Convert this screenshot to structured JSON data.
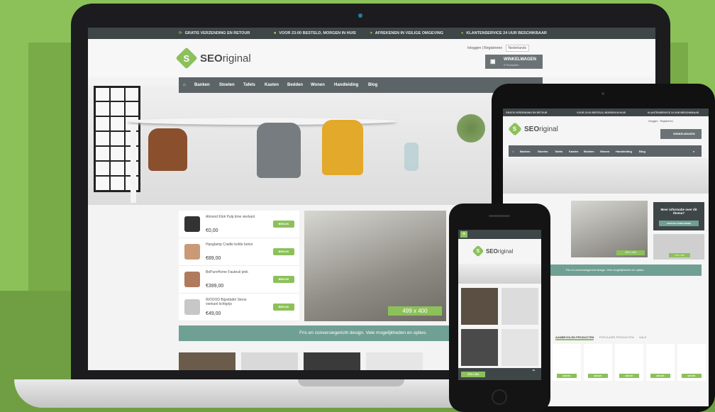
{
  "usps": [
    "GRATIS VERZENDING EN RETOUR",
    "VOOR 23:00 BESTELD, MORGEN IN HUIS",
    "AFREKENEN IN VEILIGE OMGEVING",
    "KLANTENSERVICE 24 UUR BESCHIKBAAR"
  ],
  "brand": {
    "bold": "SEO",
    "rest": "riginal",
    "mark": "S"
  },
  "header": {
    "login": "Inloggen",
    "register": "Registreren",
    "language": "Nederlands"
  },
  "cart": {
    "title": "WINKELWAGEN",
    "sub": "0 Producten"
  },
  "nav": [
    "Banken",
    "Stoelen",
    "Tafels",
    "Kasten",
    "Bedden",
    "Wonen",
    "Handleiding",
    "Blog"
  ],
  "products": [
    {
      "name": "Almond Klok Pulp time vierkant",
      "price": "€0,00",
      "button": "BEKIJK"
    },
    {
      "name": "Hanglamp Cradle bottle beton",
      "price": "€89,00",
      "button": "BEKIJK"
    },
    {
      "name": "BePureHome Fauteuil pink",
      "price": "€399,00",
      "button": "BEKIJK"
    },
    {
      "name": "WOOOD Bijzettafel Stone vierkant lichtgrijs",
      "price": "€49,00",
      "button": "BEKIJK"
    }
  ],
  "banner_size": "499 x 400",
  "fris": "Fris en conversiegericht design. Vele mogelijkheden en opties.",
  "tablet": {
    "info_title": "Meer informatie over dit thema?",
    "info_button": "LEES DE HANDLEIDING",
    "tabs": [
      "AANBEVOLEN PRODUCTEN",
      "POPULAIRE PRODUCTEN",
      "SALE"
    ],
    "size_small": "375 x 184",
    "size_mid": "499 x 400"
  },
  "phone": {
    "tag": "375 x 184"
  },
  "colors": {
    "accent": "#8cc15a",
    "teal": "#70a093",
    "dark": "#3f4648"
  }
}
